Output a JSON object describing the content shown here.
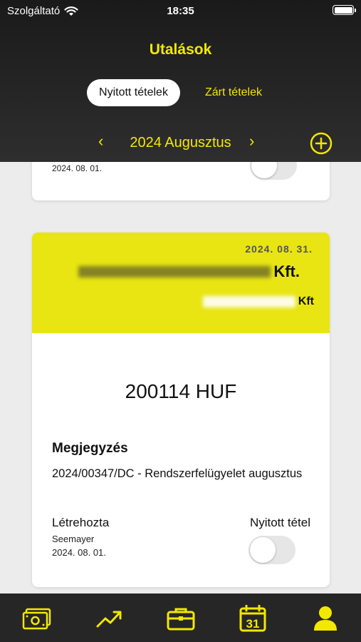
{
  "status_bar": {
    "carrier": "Szolgáltató",
    "time": "18:35"
  },
  "header": {
    "title": "Utalások"
  },
  "tabs": [
    {
      "label": "Nyitott tételek",
      "active": true
    },
    {
      "label": "Zárt tételek",
      "active": false
    }
  ],
  "month_nav": {
    "label": "2024 Augusztus"
  },
  "cards": {
    "previous": {
      "date": "2024. 08. 01.",
      "open": false
    },
    "current": {
      "date": "2024. 08. 31.",
      "company_suffix": "Kft.",
      "subcompany_suffix": "Kft",
      "amount": "200114 HUF",
      "note_label": "Megjegyzés",
      "note_text": "2024/00347/DC - Rendszerfelügyelet augusztus",
      "created_label": "Létrehozta",
      "creator": "Seemayer",
      "created_date": "2024. 08. 01.",
      "open_label": "Nyitott tétel",
      "open": false
    }
  },
  "tabbar": {
    "items": [
      {
        "icon": "money-icon"
      },
      {
        "icon": "trend-icon"
      },
      {
        "icon": "briefcase-icon"
      },
      {
        "icon": "calendar-icon",
        "text": "31"
      },
      {
        "icon": "person-icon"
      }
    ]
  },
  "colors": {
    "accent": "#f3e800",
    "banner": "#e8e512",
    "header": "#262626"
  }
}
